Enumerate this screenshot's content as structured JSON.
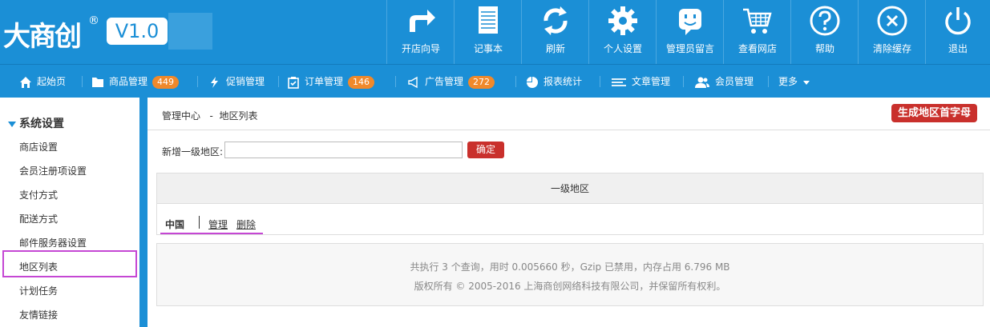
{
  "logo": {
    "text": "大商创",
    "reg": "®",
    "version": "V1.0"
  },
  "toolbar": [
    {
      "label": "开店向导",
      "icon": "share-arrow-icon"
    },
    {
      "label": "记事本",
      "icon": "notepad-icon"
    },
    {
      "label": "刷新",
      "icon": "refresh-icon"
    },
    {
      "label": "个人设置",
      "icon": "gear-icon"
    },
    {
      "label": "管理员留言",
      "icon": "message-face-icon"
    },
    {
      "label": "查看网店",
      "icon": "cart-icon"
    },
    {
      "label": "帮助",
      "icon": "help-icon"
    },
    {
      "label": "清除缓存",
      "icon": "clear-cache-icon"
    },
    {
      "label": "退出",
      "icon": "power-icon"
    }
  ],
  "nav": [
    {
      "label": "起始页",
      "icon": "home-icon"
    },
    {
      "label": "商品管理",
      "icon": "folder-icon",
      "badge": "449"
    },
    {
      "label": "促销管理",
      "icon": "flash-icon"
    },
    {
      "label": "订单管理",
      "icon": "clipboard-icon",
      "badge": "146"
    },
    {
      "label": "广告管理",
      "icon": "megaphone-icon",
      "badge": "272"
    },
    {
      "label": "报表统计",
      "icon": "pie-chart-icon"
    },
    {
      "label": "文章管理",
      "icon": "list-icon"
    },
    {
      "label": "会员管理",
      "icon": "users-icon"
    },
    {
      "label": "更多",
      "icon": "caret-down-icon"
    }
  ],
  "sidebar": {
    "heading": "系统设置",
    "items": [
      "商店设置",
      "会员注册项设置",
      "支付方式",
      "配送方式",
      "邮件服务器设置",
      "地区列表",
      "计划任务",
      "友情链接"
    ],
    "active": "地区列表"
  },
  "breadcrumb": {
    "root": "管理中心",
    "sep": "-",
    "current": "地区列表"
  },
  "generate_button": "生成地区首字母",
  "form": {
    "label": "新增一级地区:",
    "value": "",
    "submit": "确定"
  },
  "region_table": {
    "header": "一级地区",
    "rows": [
      {
        "name": "中国",
        "manage": "管理",
        "delete": "删除"
      }
    ]
  },
  "footer": {
    "line1": "共执行 3 个查询，用时 0.005660 秒，Gzip 已禁用，内存占用 6.796 MB",
    "line2": "版权所有 © 2005-2016 上海商创网络科技有限公司，并保留所有权利。"
  },
  "colors": {
    "primary": "#1b8fd6",
    "danger": "#c9302c",
    "badge": "#f0892b",
    "highlight": "#c547d4"
  }
}
